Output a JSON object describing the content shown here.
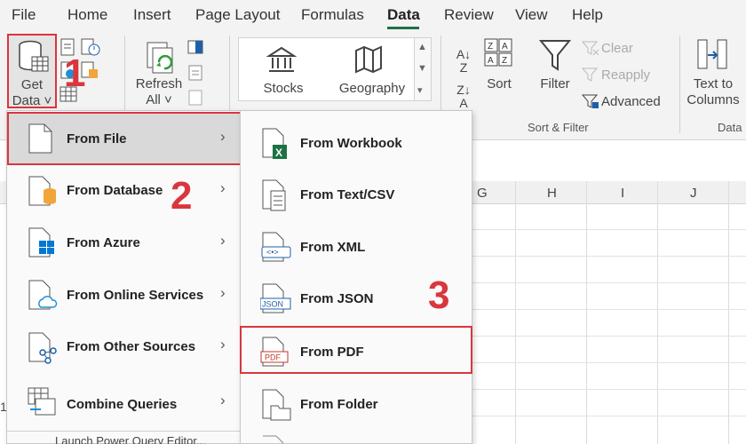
{
  "menubar": {
    "tabs": [
      "File",
      "Home",
      "Insert",
      "Page Layout",
      "Formulas",
      "Data",
      "Review",
      "View",
      "Help"
    ],
    "active_tab": "Data"
  },
  "ribbon": {
    "get_data": "Get\nData ˅",
    "refresh_all": "Refresh\nAll ˅",
    "stocks": "Stocks",
    "geography": "Geography",
    "sort_az": "A↓Z",
    "sort": "Sort",
    "filter": "Filter",
    "clear": "Clear",
    "reapply": "Reapply",
    "advanced": "Advanced",
    "text_to_columns": "Text to\nColumns",
    "group_sort_filter": "Sort & Filter",
    "group_data": "Data"
  },
  "columns": [
    "G",
    "H",
    "I",
    "J"
  ],
  "get_data_menu": {
    "items": [
      {
        "label": "From File",
        "has_submenu": true
      },
      {
        "label": "From Database",
        "has_submenu": true
      },
      {
        "label": "From Azure",
        "has_submenu": true
      },
      {
        "label": "From Online Services",
        "has_submenu": true
      },
      {
        "label": "From Other Sources",
        "has_submenu": true
      },
      {
        "label": "Combine Queries",
        "has_submenu": true
      }
    ],
    "partial_item": "Launch Power Query Editor..."
  },
  "from_file_menu": {
    "items": [
      {
        "label": "From Workbook"
      },
      {
        "label": "From Text/CSV"
      },
      {
        "label": "From XML"
      },
      {
        "label": "From JSON"
      },
      {
        "label": "From PDF"
      },
      {
        "label": "From Folder"
      }
    ]
  },
  "annotations": {
    "step1": "1",
    "step2": "2",
    "step3": "3"
  },
  "colors": {
    "accent_green": "#1e7145",
    "annotation_red": "#d9363e",
    "azure_blue": "#0078d4"
  }
}
